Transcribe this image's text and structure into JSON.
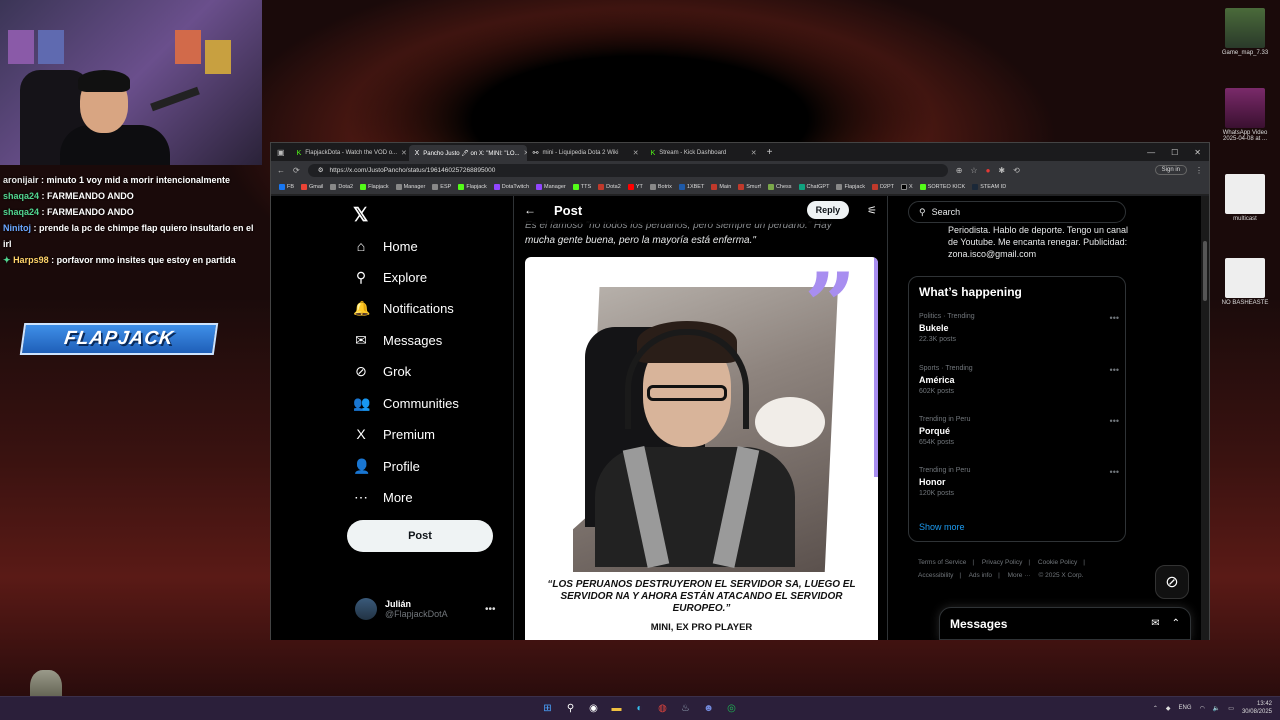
{
  "chat": [
    {
      "user": "aronijair",
      "text": ": minuto 1 voy mid a morir intencionalmente",
      "color": "#e8e8e8"
    },
    {
      "user": "shaqa24",
      "text": ": FARMEANDO ANDO",
      "color": "#52d690"
    },
    {
      "user": "shaqa24",
      "text": ": FARMEANDO ANDO",
      "color": "#52d690"
    },
    {
      "user": "Ninitoj",
      "text": ": prende la pc de chimpe flap quiero insultarlo en el irl",
      "color": "#6aa7ff"
    },
    {
      "user": "Harps98",
      "text": ": porfavor nmo insites que estoy en partida",
      "color": "#ffd36a"
    }
  ],
  "overlay": {
    "brand": "FLAPJACK"
  },
  "desktop": {
    "icons": [
      {
        "label": "Game_map_7.33"
      },
      {
        "label": "WhatsApp Video 2025-04-08 at ..."
      },
      {
        "label": "multicast"
      },
      {
        "label": "NO BASHEASTE"
      }
    ]
  },
  "browser": {
    "tabs": [
      {
        "label": "FlapjackDota - Watch the VOD o...",
        "icon": "kick-icon"
      },
      {
        "label": "Pancho Justo 🖊 on X: \"MINI: \"LO...",
        "icon": "x-icon"
      },
      {
        "label": "mini - Liquipedia Dota 2 Wiki",
        "icon": "liquipedia-icon"
      },
      {
        "label": "Stream - Kick Dashboard",
        "icon": "kick-icon"
      }
    ],
    "new_tab": "+",
    "url": "https://x.com/JustoPancho/status/1961460257268895000",
    "signin": "Sign in",
    "bookmarks": [
      "FB",
      "Gmail",
      "Dota2",
      "Flapjack",
      "Manager",
      "ESP",
      "Flapjack",
      "DotaTwitch",
      "Manager",
      "TTS",
      "Dota2",
      "YT",
      "Botrix",
      "1XBET",
      "Main",
      "Smurf",
      "Chess",
      "ChatGPT",
      "Flapjack",
      "D2PT",
      "X",
      "SORTEO KICK",
      "STEAM ID"
    ]
  },
  "x": {
    "nav": [
      {
        "label": "Home",
        "icon": "home-icon",
        "glyph": "⌂"
      },
      {
        "label": "Explore",
        "icon": "search-icon",
        "glyph": "⚲"
      },
      {
        "label": "Notifications",
        "icon": "bell-icon",
        "glyph": "🔔"
      },
      {
        "label": "Messages",
        "icon": "envelope-icon",
        "glyph": "✉"
      },
      {
        "label": "Grok",
        "icon": "grok-icon",
        "glyph": "⊘"
      },
      {
        "label": "Communities",
        "icon": "people-icon",
        "glyph": "👥"
      },
      {
        "label": "Premium",
        "icon": "x-icon",
        "glyph": "X"
      },
      {
        "label": "Profile",
        "icon": "person-icon",
        "glyph": "👤"
      },
      {
        "label": "More",
        "icon": "more-circle-icon",
        "glyph": "⋯"
      }
    ],
    "post_button": "Post",
    "account": {
      "name": "Julián",
      "handle": "@FlapjackDotA"
    },
    "header": {
      "title": "Post",
      "reply": "Reply"
    },
    "post": {
      "text_top": "Es el famoso \"no todos los peruanos, pero siempre un peruano.\" Hay",
      "text_main": "mucha gente buena, pero la mayoría está enferma.\"",
      "caption": "“LOS PERUANOS DESTRUYERON EL SERVIDOR SA, LUEGO EL SERVIDOR NA Y AHORA ESTÁN ATACANDO EL SERVIDOR EUROPEO.”",
      "author": "MINI, EX PRO PLAYER"
    },
    "search_placeholder": "Search",
    "bio": "Periodista. Hablo de deporte. Tengo un canal de Youtube. Me encanta renegar. Publicidad: zona.isco@gmail.com",
    "happening": {
      "title": "What’s happening",
      "trends": [
        {
          "meta": "Politics · Trending",
          "name": "Bukele",
          "count": "22.3K posts"
        },
        {
          "meta": "Sports · Trending",
          "name": "América",
          "count": "602K posts"
        },
        {
          "meta": "Trending in Peru",
          "name": "Porqué",
          "count": "654K posts"
        },
        {
          "meta": "Trending in Peru",
          "name": "Honor",
          "count": "120K posts"
        }
      ],
      "show_more": "Show more"
    },
    "footer": [
      "Terms of Service",
      "|",
      "Privacy Policy",
      "|",
      "Cookie Policy",
      "|",
      "Accessibility",
      "|",
      "Ads info",
      "|",
      "More ···",
      "© 2025 X Corp."
    ],
    "messages_drawer": "Messages"
  },
  "taskbar": {
    "lang": "ENG",
    "time": "13:42",
    "date": "30/08/2025"
  },
  "colors": {
    "accent": "#1d9bf0",
    "quote": "#a88ef0",
    "chat_user": "#52d690"
  }
}
